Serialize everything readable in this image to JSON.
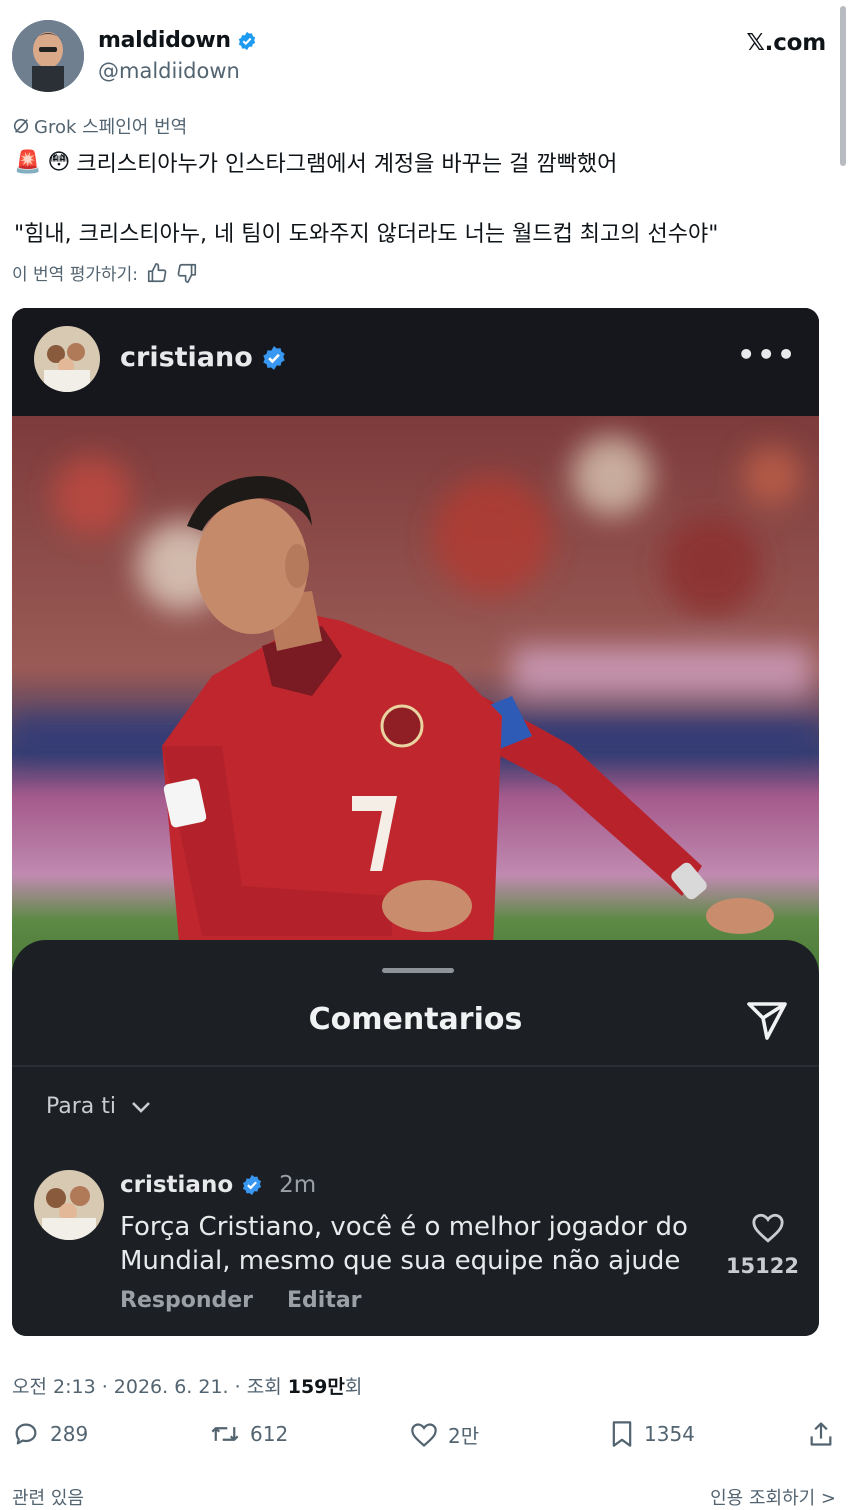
{
  "tweet": {
    "author": {
      "name": "maldidown",
      "handle": "@maldiidown",
      "verified": true
    },
    "site_logo": "𝕏.com",
    "translation_label": "Grok 스페인어 번역",
    "emoji": [
      "🚨",
      "😳"
    ],
    "line1": "크리스티아누가 인스타그램에서 계정을 바꾸는 걸 깜빡했어",
    "line2": "\"힘내, 크리스티아누, 네 팀이 도와주지 않더라도 너는 월드컵 최고의 선수야\"",
    "rate_label": "이 번역 평가하기:",
    "meta": {
      "time": "오전 2:13 · 2026. 6. 21. · 조회 ",
      "views": "159만",
      "views_suffix": "회"
    },
    "actions": {
      "replies": "289",
      "retweets": "612",
      "likes": "2만",
      "bookmarks": "1354"
    },
    "bottom_left": "관련 있음",
    "bottom_right": "인용 조회하기 >"
  },
  "embed": {
    "account": "cristiano",
    "verified": true,
    "sheet_title": "Comentarios",
    "filter": "Para ti",
    "comment": {
      "author": "cristiano",
      "time": "2m",
      "text": "Força Cristiano, você é o melhor jogador do Mundial, mesmo que sua equipe não ajude",
      "likes": "15122",
      "reply_label": "Responder",
      "edit_label": "Editar"
    }
  },
  "colors": {
    "verified": "#1d9bf0",
    "ig_verified": "#3897f0",
    "jersey": "#c0262d",
    "card_bg": "#1c1f24"
  },
  "icons": [
    "verified-badge-icon",
    "grok-icon",
    "thumbs-up-icon",
    "thumbs-down-icon",
    "more-icon",
    "send-icon",
    "chevron-down-icon",
    "heart-icon",
    "reply-icon",
    "retweet-icon",
    "like-icon",
    "bookmark-icon",
    "share-icon"
  ]
}
